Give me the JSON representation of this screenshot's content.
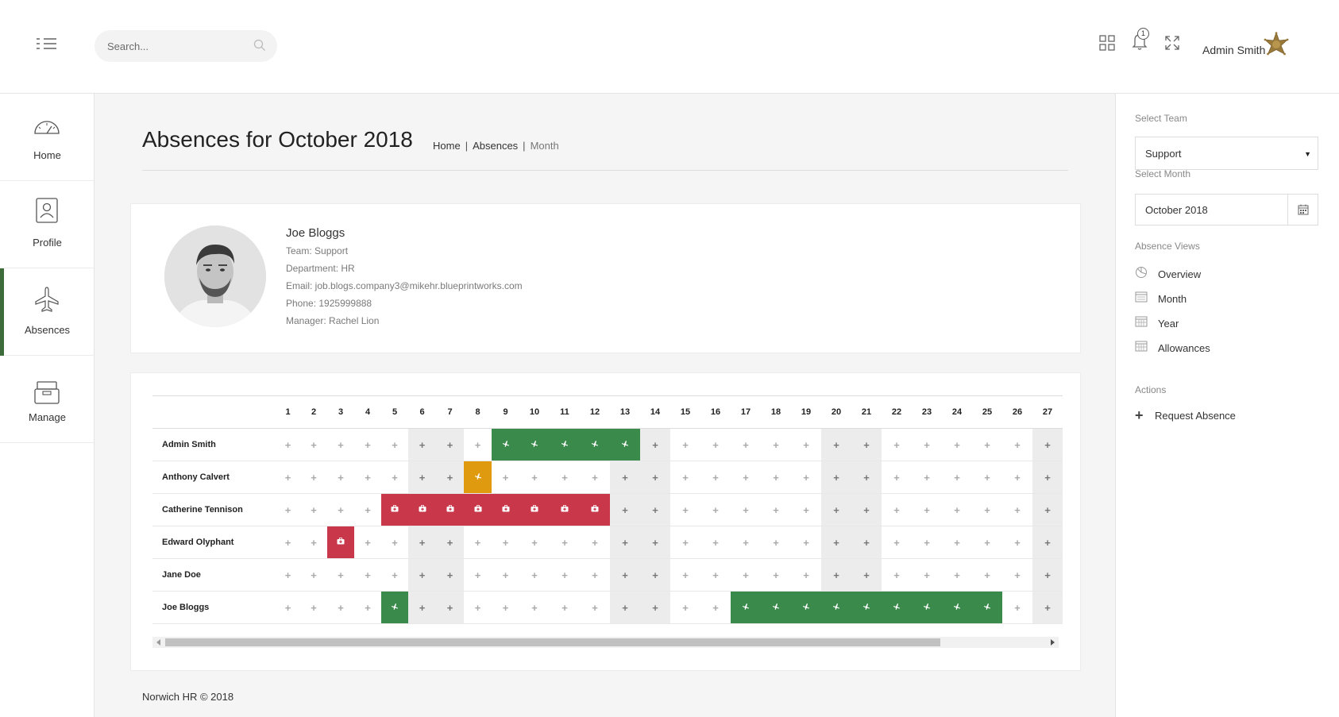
{
  "header": {
    "search_placeholder": "Search...",
    "notification_count": "1",
    "user_name": "Admin Smith"
  },
  "nav": {
    "items": [
      {
        "label": "Home",
        "icon": "dashboard-gauge-icon"
      },
      {
        "label": "Profile",
        "icon": "id-badge-icon"
      },
      {
        "label": "Absences",
        "icon": "airplane-icon"
      },
      {
        "label": "Manage",
        "icon": "archive-box-icon"
      }
    ],
    "active": "Absences"
  },
  "page": {
    "title": "Absences for October 2018",
    "breadcrumb": [
      "Home",
      "Absences",
      "Month"
    ]
  },
  "profile": {
    "name": "Joe Bloggs",
    "team": "Team: Support",
    "department": "Department: HR",
    "email": "Email: job.blogs.company3@mikehr.blueprintworks.com",
    "phone": "Phone: 1925999888",
    "manager": "Manager: Rachel Lion"
  },
  "calendar": {
    "days": [
      1,
      2,
      3,
      4,
      5,
      6,
      7,
      8,
      9,
      10,
      11,
      12,
      13,
      14,
      15,
      16,
      17,
      18,
      19,
      20,
      21,
      22,
      23,
      24,
      25,
      26,
      27
    ],
    "weekend_days": [
      6,
      7,
      13,
      14,
      20,
      21,
      27
    ],
    "rows": [
      {
        "name": "Admin Smith",
        "holiday": [
          9,
          10,
          11,
          12,
          13
        ],
        "pending": [],
        "sick": []
      },
      {
        "name": "Anthony Calvert",
        "holiday": [],
        "pending": [
          8
        ],
        "sick": []
      },
      {
        "name": "Catherine Tennison",
        "holiday": [],
        "pending": [],
        "sick": [
          5,
          6,
          7,
          8,
          9,
          10,
          11,
          12
        ]
      },
      {
        "name": "Edward Olyphant",
        "holiday": [],
        "pending": [],
        "sick": [
          3
        ]
      },
      {
        "name": "Jane Doe",
        "holiday": [],
        "pending": [],
        "sick": []
      },
      {
        "name": "Joe Bloggs",
        "holiday": [
          5,
          17,
          18,
          19,
          20,
          21,
          22,
          23,
          24,
          25
        ],
        "pending": [],
        "sick": []
      }
    ],
    "colors": {
      "holiday": "#3a8a4c",
      "pending": "#e09a10",
      "sick": "#c9384a",
      "weekend": "#ececec"
    }
  },
  "footer": {
    "text": "Norwich HR © 2018"
  },
  "sidebar": {
    "select_team_label": "Select Team",
    "team_value": "Support",
    "select_month_label": "Select Month",
    "month_value": "October 2018",
    "absence_views_label": "Absence Views",
    "views": [
      "Overview",
      "Month",
      "Year",
      "Allowances"
    ],
    "actions_label": "Actions",
    "request_absence": "Request Absence"
  }
}
